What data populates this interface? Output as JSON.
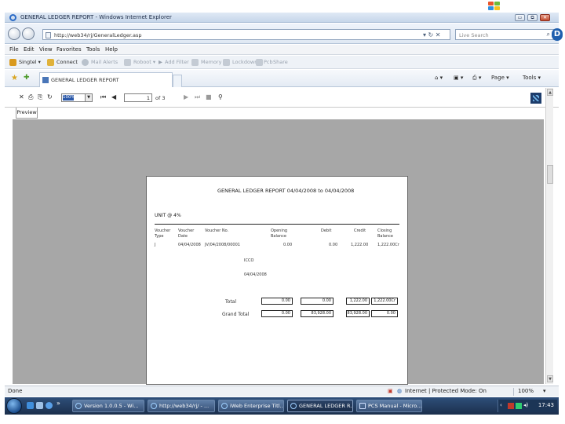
{
  "window": {
    "title": "GENERAL LEDGER REPORT - Windows Internet Explorer",
    "min_label": "▭",
    "max_label": "⧉",
    "close_label": "✕"
  },
  "address_bar": {
    "url": "http://web34/rj/GeneralLedger.asp",
    "go_label": "▾ ↻ ✕",
    "search_placeholder": "Live Search"
  },
  "menu": {
    "items": [
      "File",
      "Edit",
      "View",
      "Favorites",
      "Tools",
      "Help"
    ]
  },
  "toolbar_links": {
    "items": [
      "Singtel ▾",
      "Connect",
      "Mail Alerts",
      "Roboot ▾",
      "Add Filter",
      "Memory ▾",
      "Lockdown",
      "Pcb",
      "Share"
    ]
  },
  "tab_row": {
    "tab_title": "GENERAL LEDGER REPORT",
    "tools": [
      "Page ▾",
      "Tools ▾"
    ]
  },
  "viewer_toolbar": {
    "zoom_value": "100%",
    "current_page": "1",
    "of_pages": "of 3",
    "preview_tab": "Preview"
  },
  "report": {
    "title": "GENERAL LEDGER REPORT  04/04/2008  to  04/04/2008",
    "account": "UNIT @ 4%",
    "columns": [
      {
        "line1": "Voucher",
        "line2": "Type"
      },
      {
        "line1": "Voucher",
        "line2": "Date"
      },
      {
        "line1": "Voucher No.",
        "line2": ""
      },
      {
        "line1": "Opening",
        "line2": "Balance"
      },
      {
        "line1": "Debit",
        "line2": ""
      },
      {
        "line1": "Credit",
        "line2": ""
      },
      {
        "line1": "Closing",
        "line2": "Balance"
      }
    ],
    "row": {
      "type": "J",
      "date": "04/04/2008",
      "voucher_no": "JV/04/2008/00001",
      "opening": "0.00",
      "debit": "0.00",
      "credit": "1,222.00",
      "closing": "1,222.00Cr"
    },
    "extra_1": "ICCO",
    "extra_2": "04/04/2008",
    "total_label": "Total",
    "totals": [
      "0.00",
      "0.00",
      "1,222.00",
      "1,222.00Cr"
    ],
    "grand_total_label": "Grand Total",
    "grand_totals": [
      "0.00",
      "83,928.00",
      "83,928.00",
      "0.00"
    ]
  },
  "status_bar": {
    "text": "Done",
    "zone": "Internet | Protected Mode: On",
    "zoom": "100%"
  },
  "taskbar": {
    "tasks": [
      {
        "label": "Version 1.0.0.5 - Wi...",
        "active": false
      },
      {
        "label": "http://web34/rj/ - ...",
        "active": false
      },
      {
        "label": "iWeb Enterprise Titl...",
        "active": false
      },
      {
        "label": "GENERAL LEDGER R...",
        "active": true
      },
      {
        "label": "PCS Manual - Micro...",
        "active": false
      }
    ],
    "clock": "17:43"
  },
  "colors": {
    "viewer_background": "#a7a7a7",
    "taskbar": "#1b2f4c",
    "selection": "#2b58a8"
  }
}
